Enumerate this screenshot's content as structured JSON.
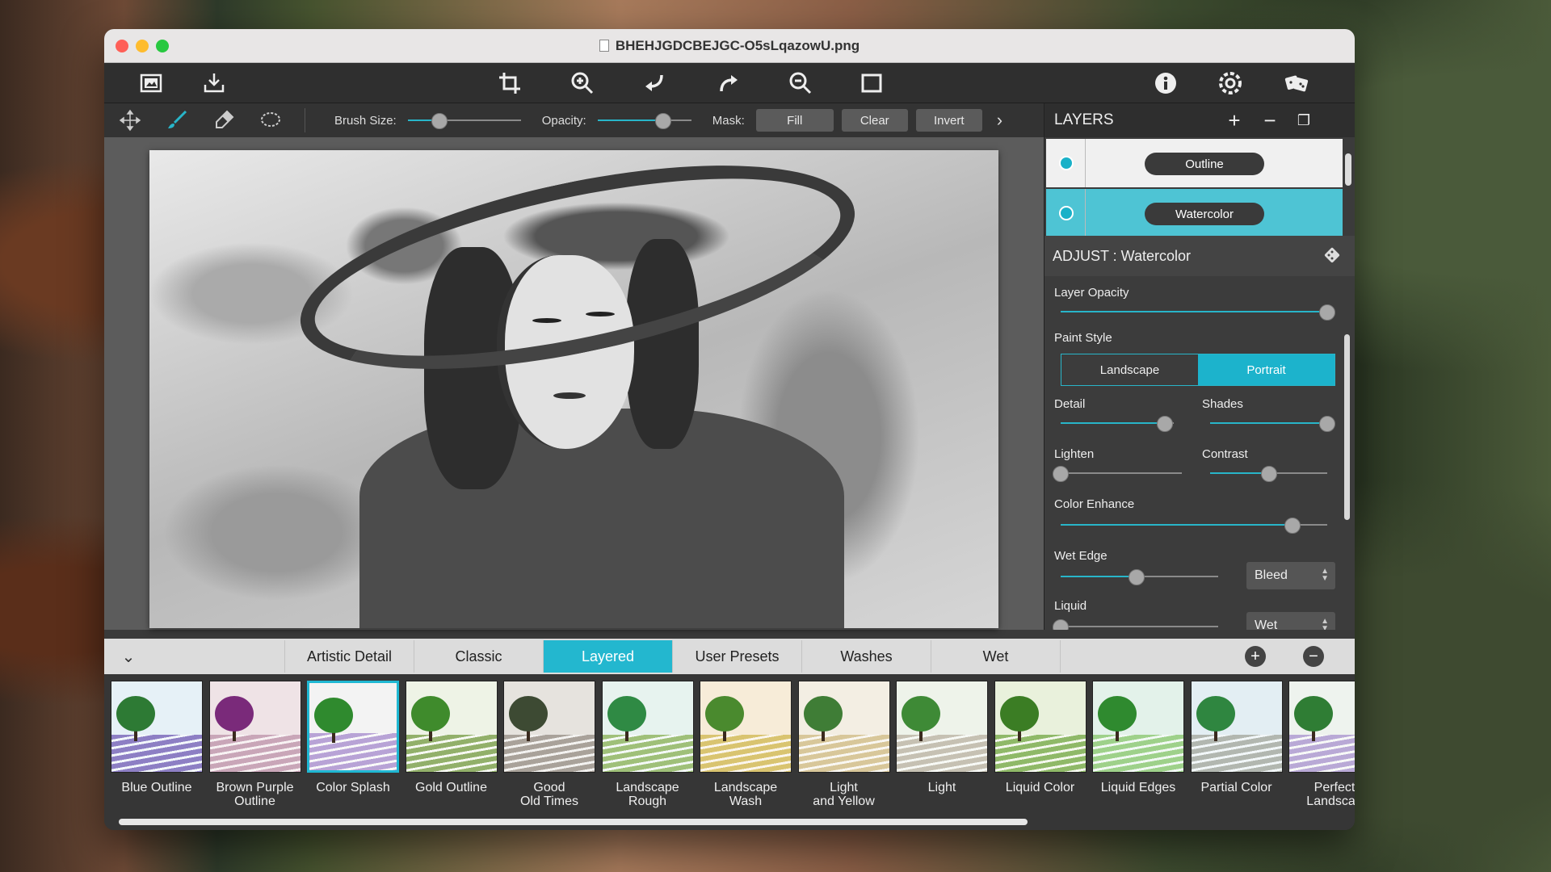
{
  "window": {
    "title": "BHEHJGDCBEJGC-O5sLqazowU.png"
  },
  "toolbar": {
    "icons": [
      "open-image-icon",
      "export-icon",
      "crop-icon",
      "zoom-in-icon",
      "undo-icon",
      "redo-icon",
      "zoom-out-icon",
      "fit-screen-icon",
      "info-icon",
      "settings-icon",
      "randomize-dice-icon"
    ]
  },
  "options": {
    "brush_size_label": "Brush Size:",
    "brush_size_value": 0.28,
    "opacity_label": "Opacity:",
    "opacity_value": 0.7,
    "mask_label": "Mask:",
    "fill_label": "Fill",
    "clear_label": "Clear",
    "invert_label": "Invert"
  },
  "layers": {
    "header": "LAYERS",
    "items": [
      {
        "name": "Outline",
        "selected": false
      },
      {
        "name": "Watercolor",
        "selected": true
      }
    ]
  },
  "adjust": {
    "header": "ADJUST : Watercolor",
    "layer_opacity_label": "Layer Opacity",
    "layer_opacity": 1.0,
    "paint_style_label": "Paint Style",
    "paint_style_options": [
      "Landscape",
      "Portrait"
    ],
    "paint_style_selected": "Portrait",
    "detail_label": "Detail",
    "detail": 0.92,
    "shades_label": "Shades",
    "shades": 1.0,
    "lighten_label": "Lighten",
    "lighten": 0.0,
    "contrast_label": "Contrast",
    "contrast": 0.5,
    "color_enhance_label": "Color Enhance",
    "color_enhance": 0.87,
    "wet_edge_label": "Wet Edge",
    "wet_edge": 0.48,
    "wet_edge_mode": "Bleed",
    "liquid_label": "Liquid",
    "liquid_mode": "Wet"
  },
  "tabs": [
    "Artistic Detail",
    "Classic",
    "Layered",
    "User Presets",
    "Washes",
    "Wet"
  ],
  "active_tab": "Layered",
  "presets": [
    {
      "label": "Blue Outline",
      "sky": "#e6f1f7",
      "tree": "#2d7a34",
      "field": "#8d7fc4"
    },
    {
      "label": "Brown Purple\nOutline",
      "sky": "#efe3e6",
      "tree": "#7a2a7a",
      "field": "#c9a6b8"
    },
    {
      "label": "Color Splash",
      "sky": "#f3f3f3",
      "tree": "#2f8a2e",
      "field": "#b8a3d6"
    },
    {
      "label": "Gold Outline",
      "sky": "#eef3e6",
      "tree": "#3f8b2c",
      "field": "#92b06a"
    },
    {
      "label": "Good\nOld Times",
      "sky": "#e6e3de",
      "tree": "#3d4a33",
      "field": "#a9a29a"
    },
    {
      "label": "Landscape\nRough",
      "sky": "#e7f3ef",
      "tree": "#2f8a44",
      "field": "#9fc079"
    },
    {
      "label": "Landscape\nWash",
      "sky": "#f7ecd8",
      "tree": "#4a8a2e",
      "field": "#d9c470"
    },
    {
      "label": "Light\nand Yellow",
      "sky": "#f3eee3",
      "tree": "#3f7d36",
      "field": "#d8c79a"
    },
    {
      "label": "Light",
      "sky": "#eef3ea",
      "tree": "#3e8a36",
      "field": "#c6c1b3"
    },
    {
      "label": "Liquid Color",
      "sky": "#e9f1dc",
      "tree": "#3b7d24",
      "field": "#8fb968"
    },
    {
      "label": "Liquid Edges",
      "sky": "#e3f2ea",
      "tree": "#2f8a2f",
      "field": "#9ed18a"
    },
    {
      "label": "Partial Color",
      "sky": "#e3eef3",
      "tree": "#2f8640",
      "field": "#b2b7b0"
    },
    {
      "label": "Perfect\nLandscap",
      "sky": "#eef3ee",
      "tree": "#2f7d34",
      "field": "#b9a9d6"
    }
  ],
  "selected_preset": "Color Splash",
  "colors": {
    "accent": "#1cb3cc"
  }
}
